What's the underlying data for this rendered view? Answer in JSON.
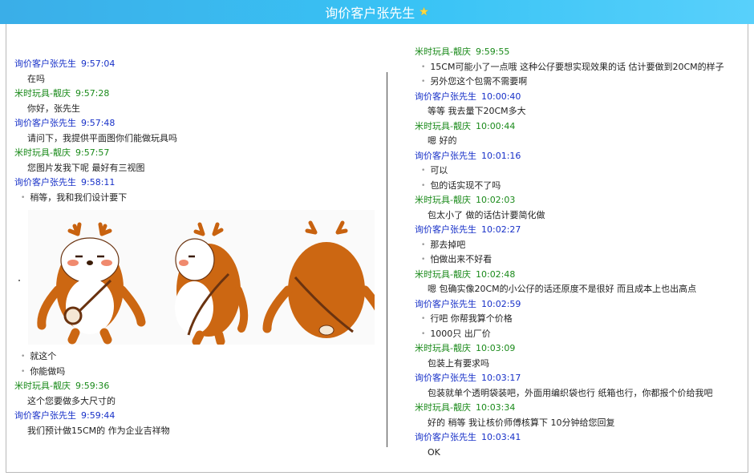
{
  "window": {
    "title": "询价客户张先生",
    "title_icon": "star-icon",
    "title_icon_color": "#ffd83d",
    "titlebar_color": "#39c3f5"
  },
  "colors": {
    "customer": "#1730c8",
    "seller": "#1a8a1a"
  },
  "left": [
    {
      "type": "header",
      "role": "customer",
      "name": "询价客户张先生",
      "time": "9:57:04"
    },
    {
      "type": "line",
      "style": "plain",
      "text": "在吗"
    },
    {
      "type": "header",
      "role": "seller",
      "name": "米时玩具-靓庆",
      "time": "9:57:28"
    },
    {
      "type": "line",
      "style": "plain",
      "text": "你好，张先生"
    },
    {
      "type": "header",
      "role": "customer",
      "name": "询价客户张先生",
      "time": "9:57:48"
    },
    {
      "type": "line",
      "style": "plain",
      "text": "请问下，我提供平面图你们能做玩具吗"
    },
    {
      "type": "header",
      "role": "seller",
      "name": "米时玩具-靓庆",
      "time": "9:57:57"
    },
    {
      "type": "line",
      "style": "plain",
      "text": "您图片发我下呢 最好有三视图"
    },
    {
      "type": "header",
      "role": "customer",
      "name": "询价客户张先生",
      "time": "9:58:11"
    },
    {
      "type": "line",
      "style": "bullet",
      "text": "稍等，我和我们设计要下"
    },
    {
      "type": "image",
      "name": "deer-three-view-image"
    },
    {
      "type": "line",
      "style": "bullet",
      "text": "就这个"
    },
    {
      "type": "line",
      "style": "bullet",
      "text": "你能做吗"
    },
    {
      "type": "header",
      "role": "seller",
      "name": "米时玩具-靓庆",
      "time": "9:59:36"
    },
    {
      "type": "line",
      "style": "plain",
      "text": "这个您要做多大尺寸的"
    },
    {
      "type": "header",
      "role": "customer",
      "name": "询价客户张先生",
      "time": "9:59:44"
    },
    {
      "type": "line",
      "style": "plain",
      "text": "我们预计做15CM的 作为企业吉祥物"
    }
  ],
  "right": [
    {
      "type": "header",
      "role": "seller",
      "name": "米时玩具-靓庆",
      "time": "9:59:55"
    },
    {
      "type": "line",
      "style": "bullet",
      "text": "15CM可能小了一点哦 这种公仔要想实现效果的话 估计要做到20CM的样子"
    },
    {
      "type": "line",
      "style": "bullet",
      "text": "另外您这个包需不需要啊"
    },
    {
      "type": "header",
      "role": "customer",
      "name": "询价客户张先生",
      "time": "10:00:40"
    },
    {
      "type": "line",
      "style": "plain",
      "text": "等等 我去量下20CM多大"
    },
    {
      "type": "header",
      "role": "seller",
      "name": "米时玩具-靓庆",
      "time": "10:00:44"
    },
    {
      "type": "line",
      "style": "plain",
      "text": "嗯 好的"
    },
    {
      "type": "header",
      "role": "customer",
      "name": "询价客户张先生",
      "time": "10:01:16"
    },
    {
      "type": "line",
      "style": "bullet",
      "text": "可以"
    },
    {
      "type": "line",
      "style": "bullet",
      "text": "包的话实现不了吗"
    },
    {
      "type": "header",
      "role": "seller",
      "name": "米时玩具-靓庆",
      "time": "10:02:03"
    },
    {
      "type": "line",
      "style": "plain",
      "text": "包太小了 做的话估计要简化做"
    },
    {
      "type": "header",
      "role": "customer",
      "name": "询价客户张先生",
      "time": "10:02:27"
    },
    {
      "type": "line",
      "style": "bullet",
      "text": "那去掉吧"
    },
    {
      "type": "line",
      "style": "bullet",
      "text": "怕做出来不好看"
    },
    {
      "type": "header",
      "role": "seller",
      "name": "米时玩具-靓庆",
      "time": "10:02:48"
    },
    {
      "type": "line",
      "style": "plain",
      "text": "嗯 包确实像20CM的小公仔的话还原度不是很好 而且成本上也出高点"
    },
    {
      "type": "header",
      "role": "customer",
      "name": "询价客户张先生",
      "time": "10:02:59"
    },
    {
      "type": "line",
      "style": "bullet",
      "text": "行吧 你帮我算个价格"
    },
    {
      "type": "line",
      "style": "bullet",
      "text": "1000只 出厂价"
    },
    {
      "type": "header",
      "role": "seller",
      "name": "米时玩具-靓庆",
      "time": "10:03:09"
    },
    {
      "type": "line",
      "style": "plain",
      "text": "包装上有要求吗"
    },
    {
      "type": "header",
      "role": "customer",
      "name": "询价客户张先生",
      "time": "10:03:17"
    },
    {
      "type": "line",
      "style": "plain",
      "text": "包装就单个透明袋装吧，外面用编织袋也行 纸箱也行，你都报个价给我吧"
    },
    {
      "type": "header",
      "role": "seller",
      "name": "米时玩具-靓庆",
      "time": "10:03:34"
    },
    {
      "type": "line",
      "style": "plain",
      "text": "好的 稍等 我让核价师傅核算下 10分钟给您回复"
    },
    {
      "type": "header",
      "role": "customer",
      "name": "询价客户张先生",
      "time": "10:03:41"
    },
    {
      "type": "line",
      "style": "plain",
      "text": "OK"
    }
  ]
}
